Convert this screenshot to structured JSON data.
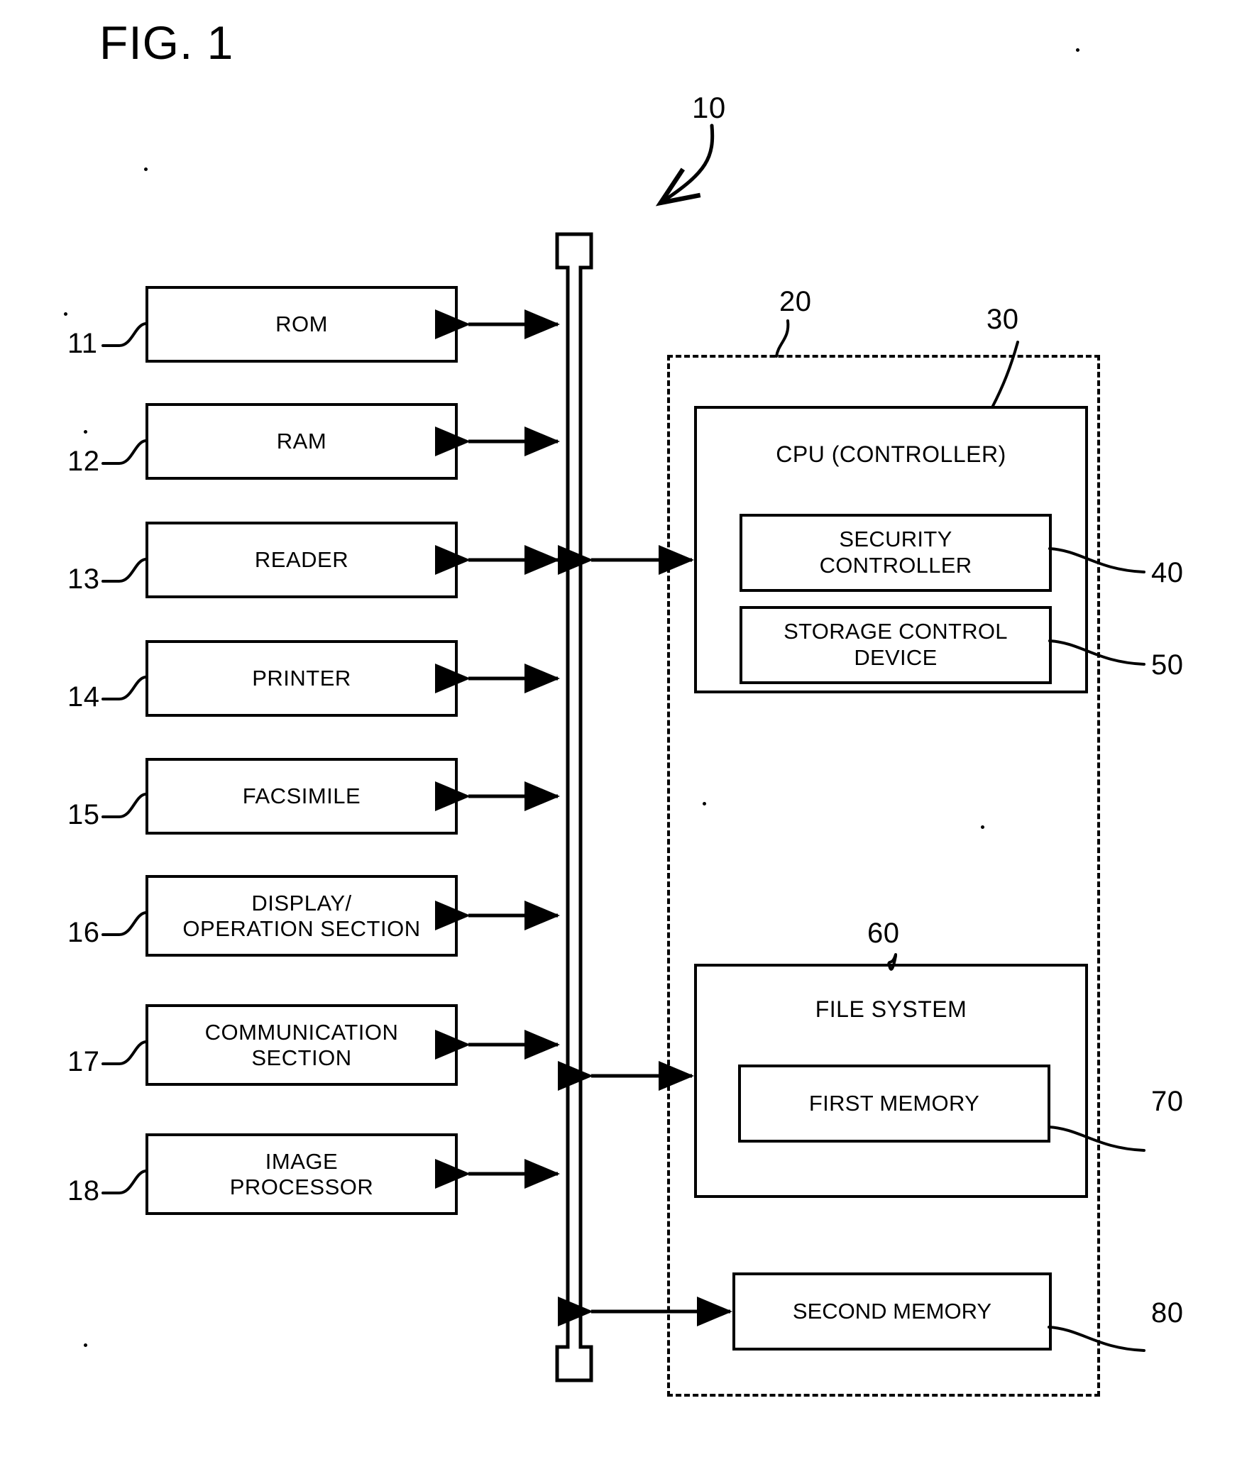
{
  "figure": {
    "title": "FIG. 1",
    "system_ref": "10"
  },
  "left_column": {
    "boxes": [
      {
        "ref": "11",
        "label": "ROM"
      },
      {
        "ref": "12",
        "label": "RAM"
      },
      {
        "ref": "13",
        "label": "READER"
      },
      {
        "ref": "14",
        "label": "PRINTER"
      },
      {
        "ref": "15",
        "label": "FACSIMILE"
      },
      {
        "ref": "16",
        "label": "DISPLAY/\nOPERATION SECTION"
      },
      {
        "ref": "17",
        "label": "COMMUNICATION\nSECTION"
      },
      {
        "ref": "18",
        "label": "IMAGE\nPROCESSOR"
      }
    ]
  },
  "bus": {
    "name": "system-bus"
  },
  "right_group": {
    "ref": "20",
    "cpu": {
      "ref": "30",
      "label": "CPU (CONTROLLER)",
      "children": [
        {
          "ref": "40",
          "label": "SECURITY\nCONTROLLER"
        },
        {
          "ref": "50",
          "label": "STORAGE CONTROL\nDEVICE"
        }
      ]
    },
    "file_system": {
      "ref": "60",
      "label": "FILE SYSTEM",
      "children": [
        {
          "ref": "70",
          "label": "FIRST MEMORY"
        }
      ]
    },
    "second_memory": {
      "ref": "80",
      "label": "SECOND MEMORY"
    }
  }
}
